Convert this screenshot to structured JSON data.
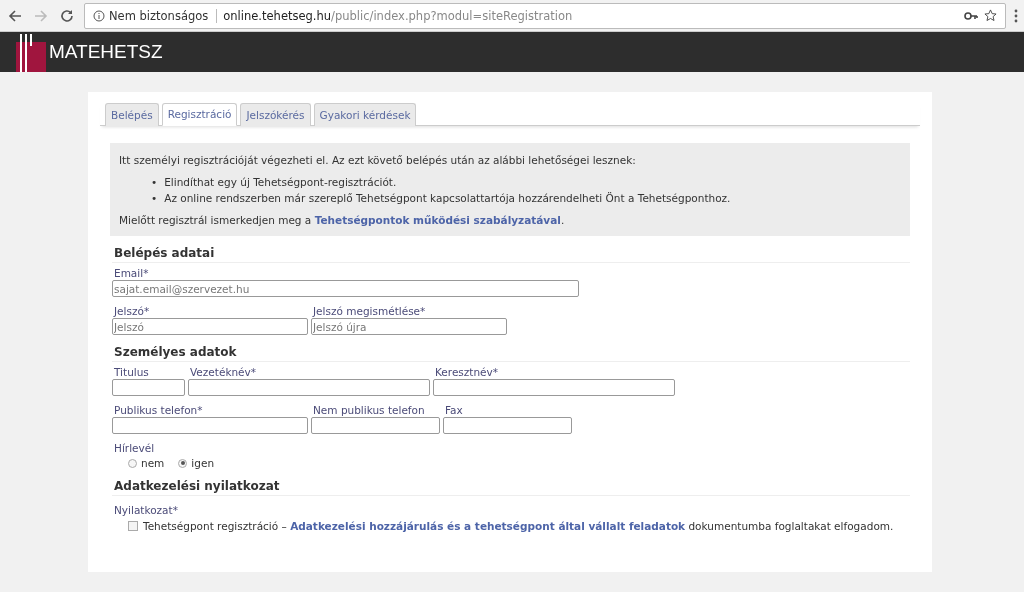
{
  "browser": {
    "security": "Nem biztonságos",
    "url": "**online.tehetseg.hu**/public/index.php?modul=siteRegistration"
  },
  "site": {
    "name": "MATEHETSZ"
  },
  "tabs": [
    {
      "label": "Belépés",
      "selected": false
    },
    {
      "label": "Regisztráció",
      "selected": true
    },
    {
      "label": "Jelszókérés",
      "selected": false
    },
    {
      "label": "Gyakori kérdések",
      "selected": false
    }
  ],
  "info": {
    "intro": "Itt személyi regisztrációját végezheti el. Az ezt követő belépés után az alábbi lehetőségei lesznek:",
    "marker": "•",
    "bullets": [
      "Elindíthat egy új Tehetségpont-regisztrációt.",
      "Az online rendszerben már szereplő Tehetségpont kapcsolattartója hozzárendelheti Önt a Tehetségponthoz."
    ],
    "note": {
      "before": "Mielőtt regisztrál ismerkedjen meg a ",
      "link": "Tehetségpontok működési szabályzatával",
      "after": "."
    }
  },
  "sections": [
    {
      "title": "Belépés adatai",
      "rows": [
        [
          {
            "label": "Email*",
            "placeholder": "sajat.email@szervezet.hu"
          }
        ],
        [
          {
            "label": "Jelszó*",
            "placeholder": "Jelszó"
          },
          {
            "label": "Jelszó megismétlése*",
            "placeholder": "Jelszó újra"
          }
        ]
      ]
    },
    {
      "title": "Személyes adatok",
      "rows": [
        [
          {
            "label": "Titulus"
          },
          {
            "label": "Vezetéknév*"
          },
          {
            "label": "Keresztnév*"
          }
        ],
        [
          {
            "label": "Publikus telefon*"
          },
          {
            "label": "Nem publikus telefon"
          },
          {
            "label": "Fax"
          }
        ]
      ],
      "radio_group": {
        "label": "Hírlevél",
        "options": [
          {
            "label": "nem",
            "selected": false
          },
          {
            "label": "igen",
            "selected": true
          }
        ]
      }
    },
    {
      "title": "Adatkezelési nyilatkozat",
      "consent": {
        "label": "Nyilatkozat*",
        "checked": false,
        "before": "Tehetségpont regisztráció – ",
        "link": "Adatkezelési hozzájárulás és a tehetségpont által vállalt feladatok",
        "after": " dokumentumba foglaltakat elfogadom."
      }
    }
  ]
}
